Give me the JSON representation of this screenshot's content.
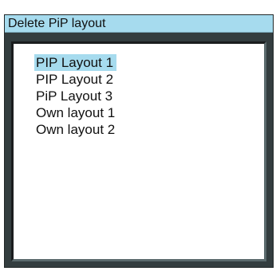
{
  "dialog": {
    "title": "Delete PiP layout",
    "colors": {
      "title_bar": "#a6dbee",
      "frame": "#333d3f",
      "selection": "#a6dbee",
      "list_background": "#ffffff"
    }
  },
  "layouts": {
    "selected_index": 0,
    "items": [
      {
        "label": "PIP Layout 1"
      },
      {
        "label": "PIP Layout 2"
      },
      {
        "label": "PiP Layout 3"
      },
      {
        "label": "Own layout 1"
      },
      {
        "label": "Own layout 2"
      }
    ]
  }
}
